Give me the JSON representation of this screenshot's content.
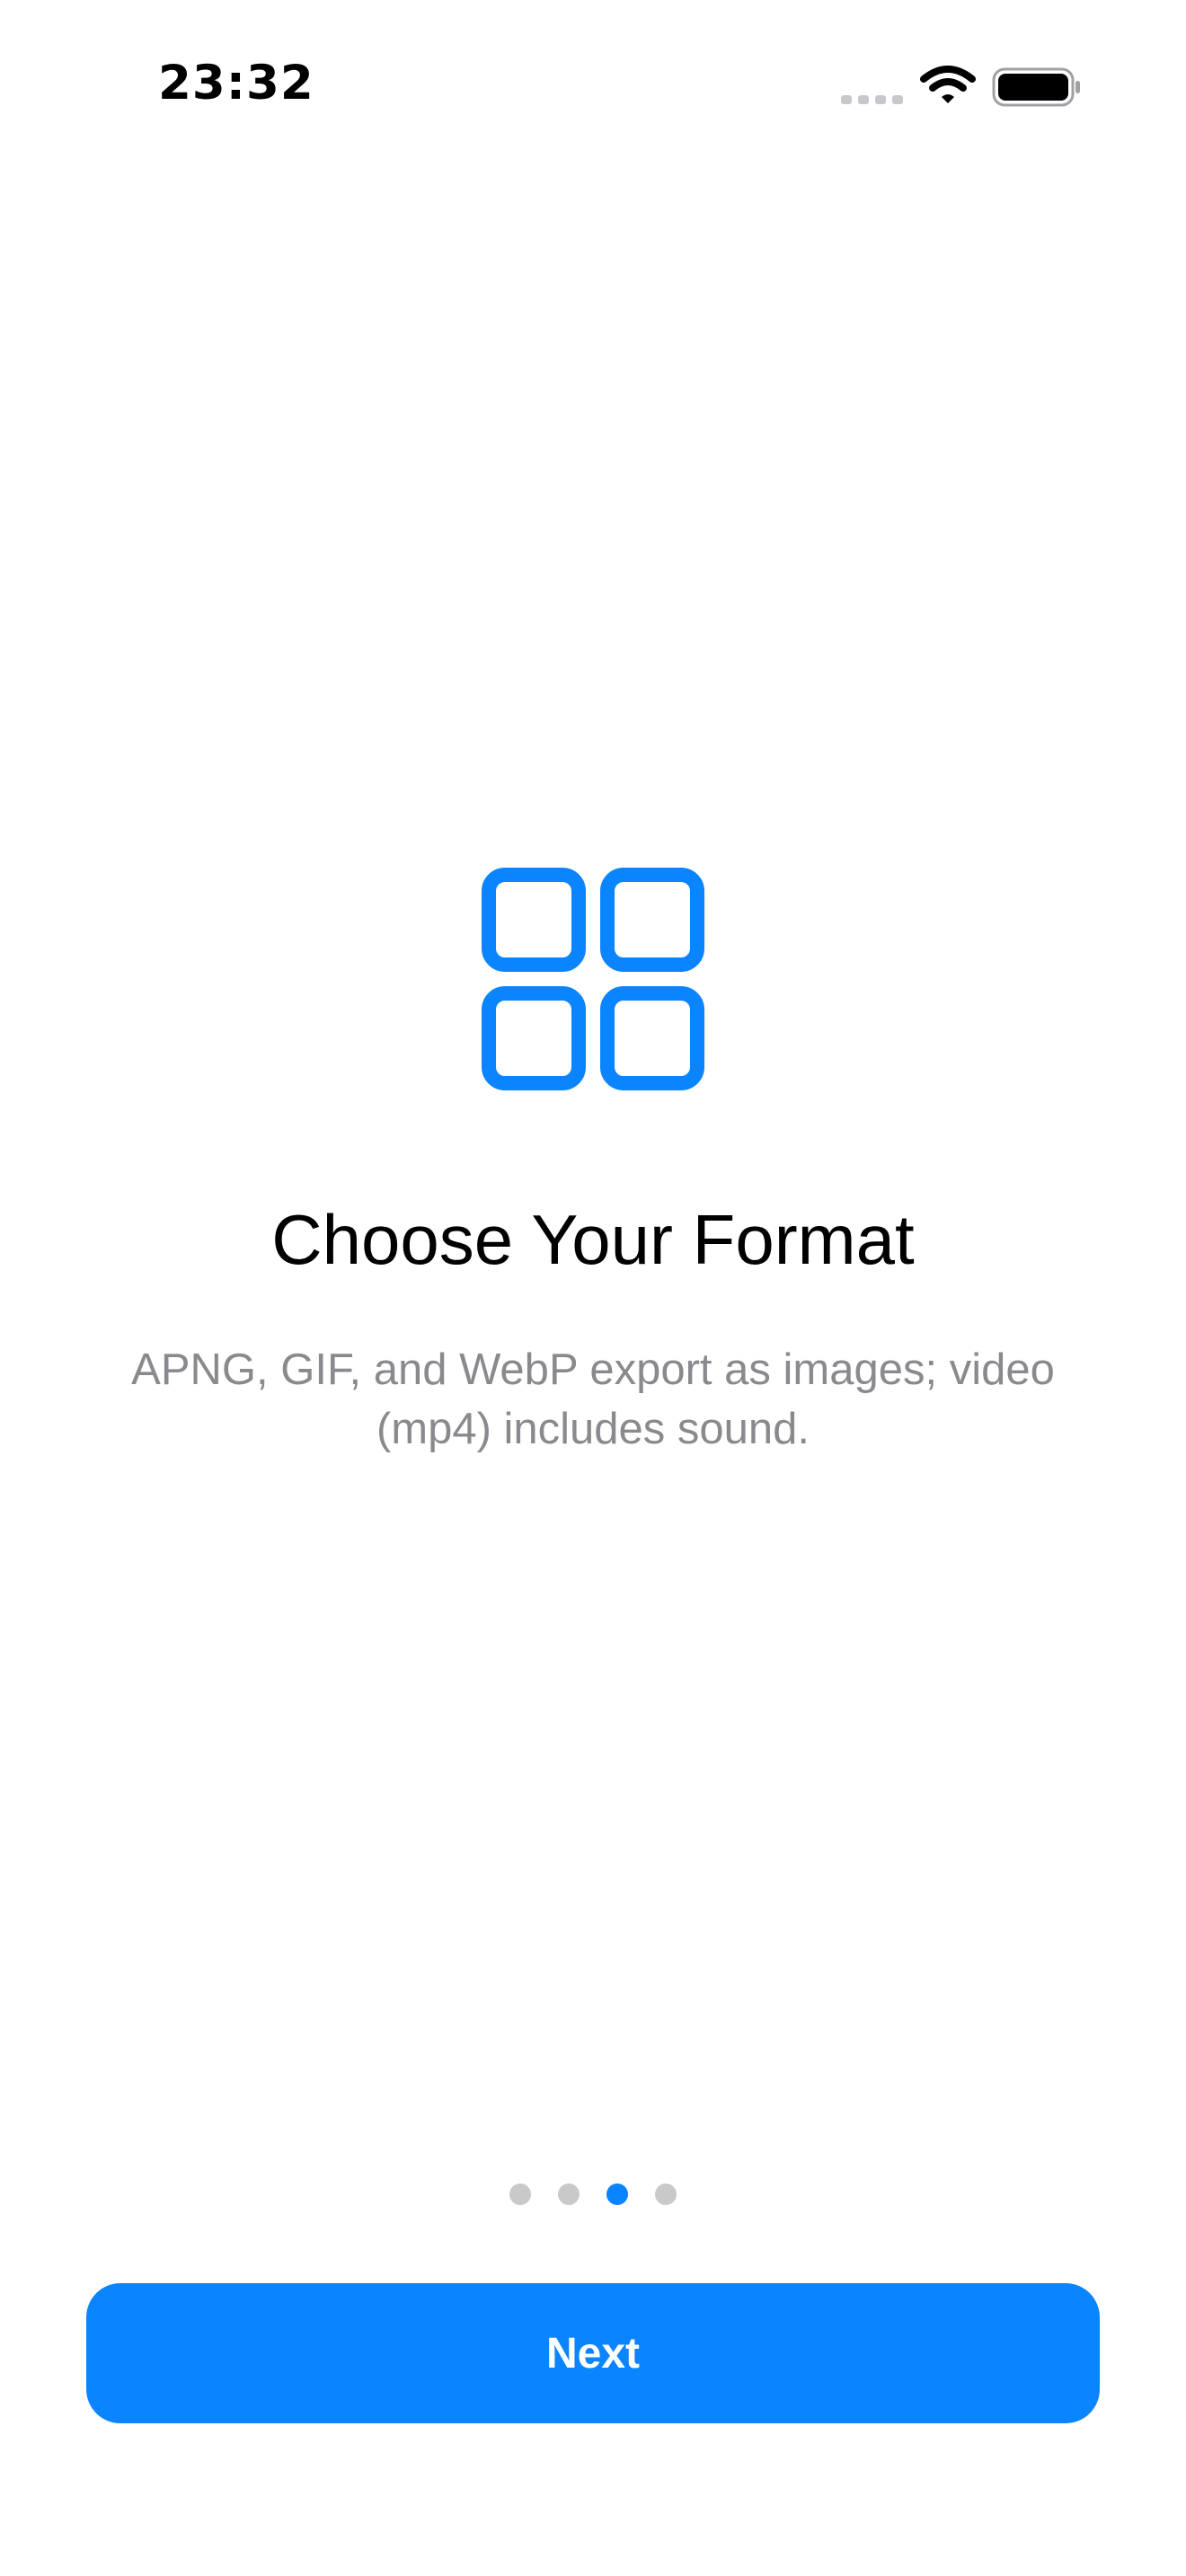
{
  "status_bar": {
    "time": "23:32",
    "signal_icon": "cellular-signal-icon",
    "wifi_icon": "wifi-icon",
    "battery_icon": "battery-icon"
  },
  "onboarding": {
    "icon": "grid-2x2-icon",
    "title": "Choose Your Format",
    "description": "APNG, GIF, and WebP export as images; video (mp4) includes sound.",
    "page_count": 4,
    "current_page": 3,
    "next_button_label": "Next"
  },
  "colors": {
    "accent": "#0A84FF",
    "secondary_text": "#8A8A8E",
    "inactive_dot": "#C9C9CC"
  }
}
